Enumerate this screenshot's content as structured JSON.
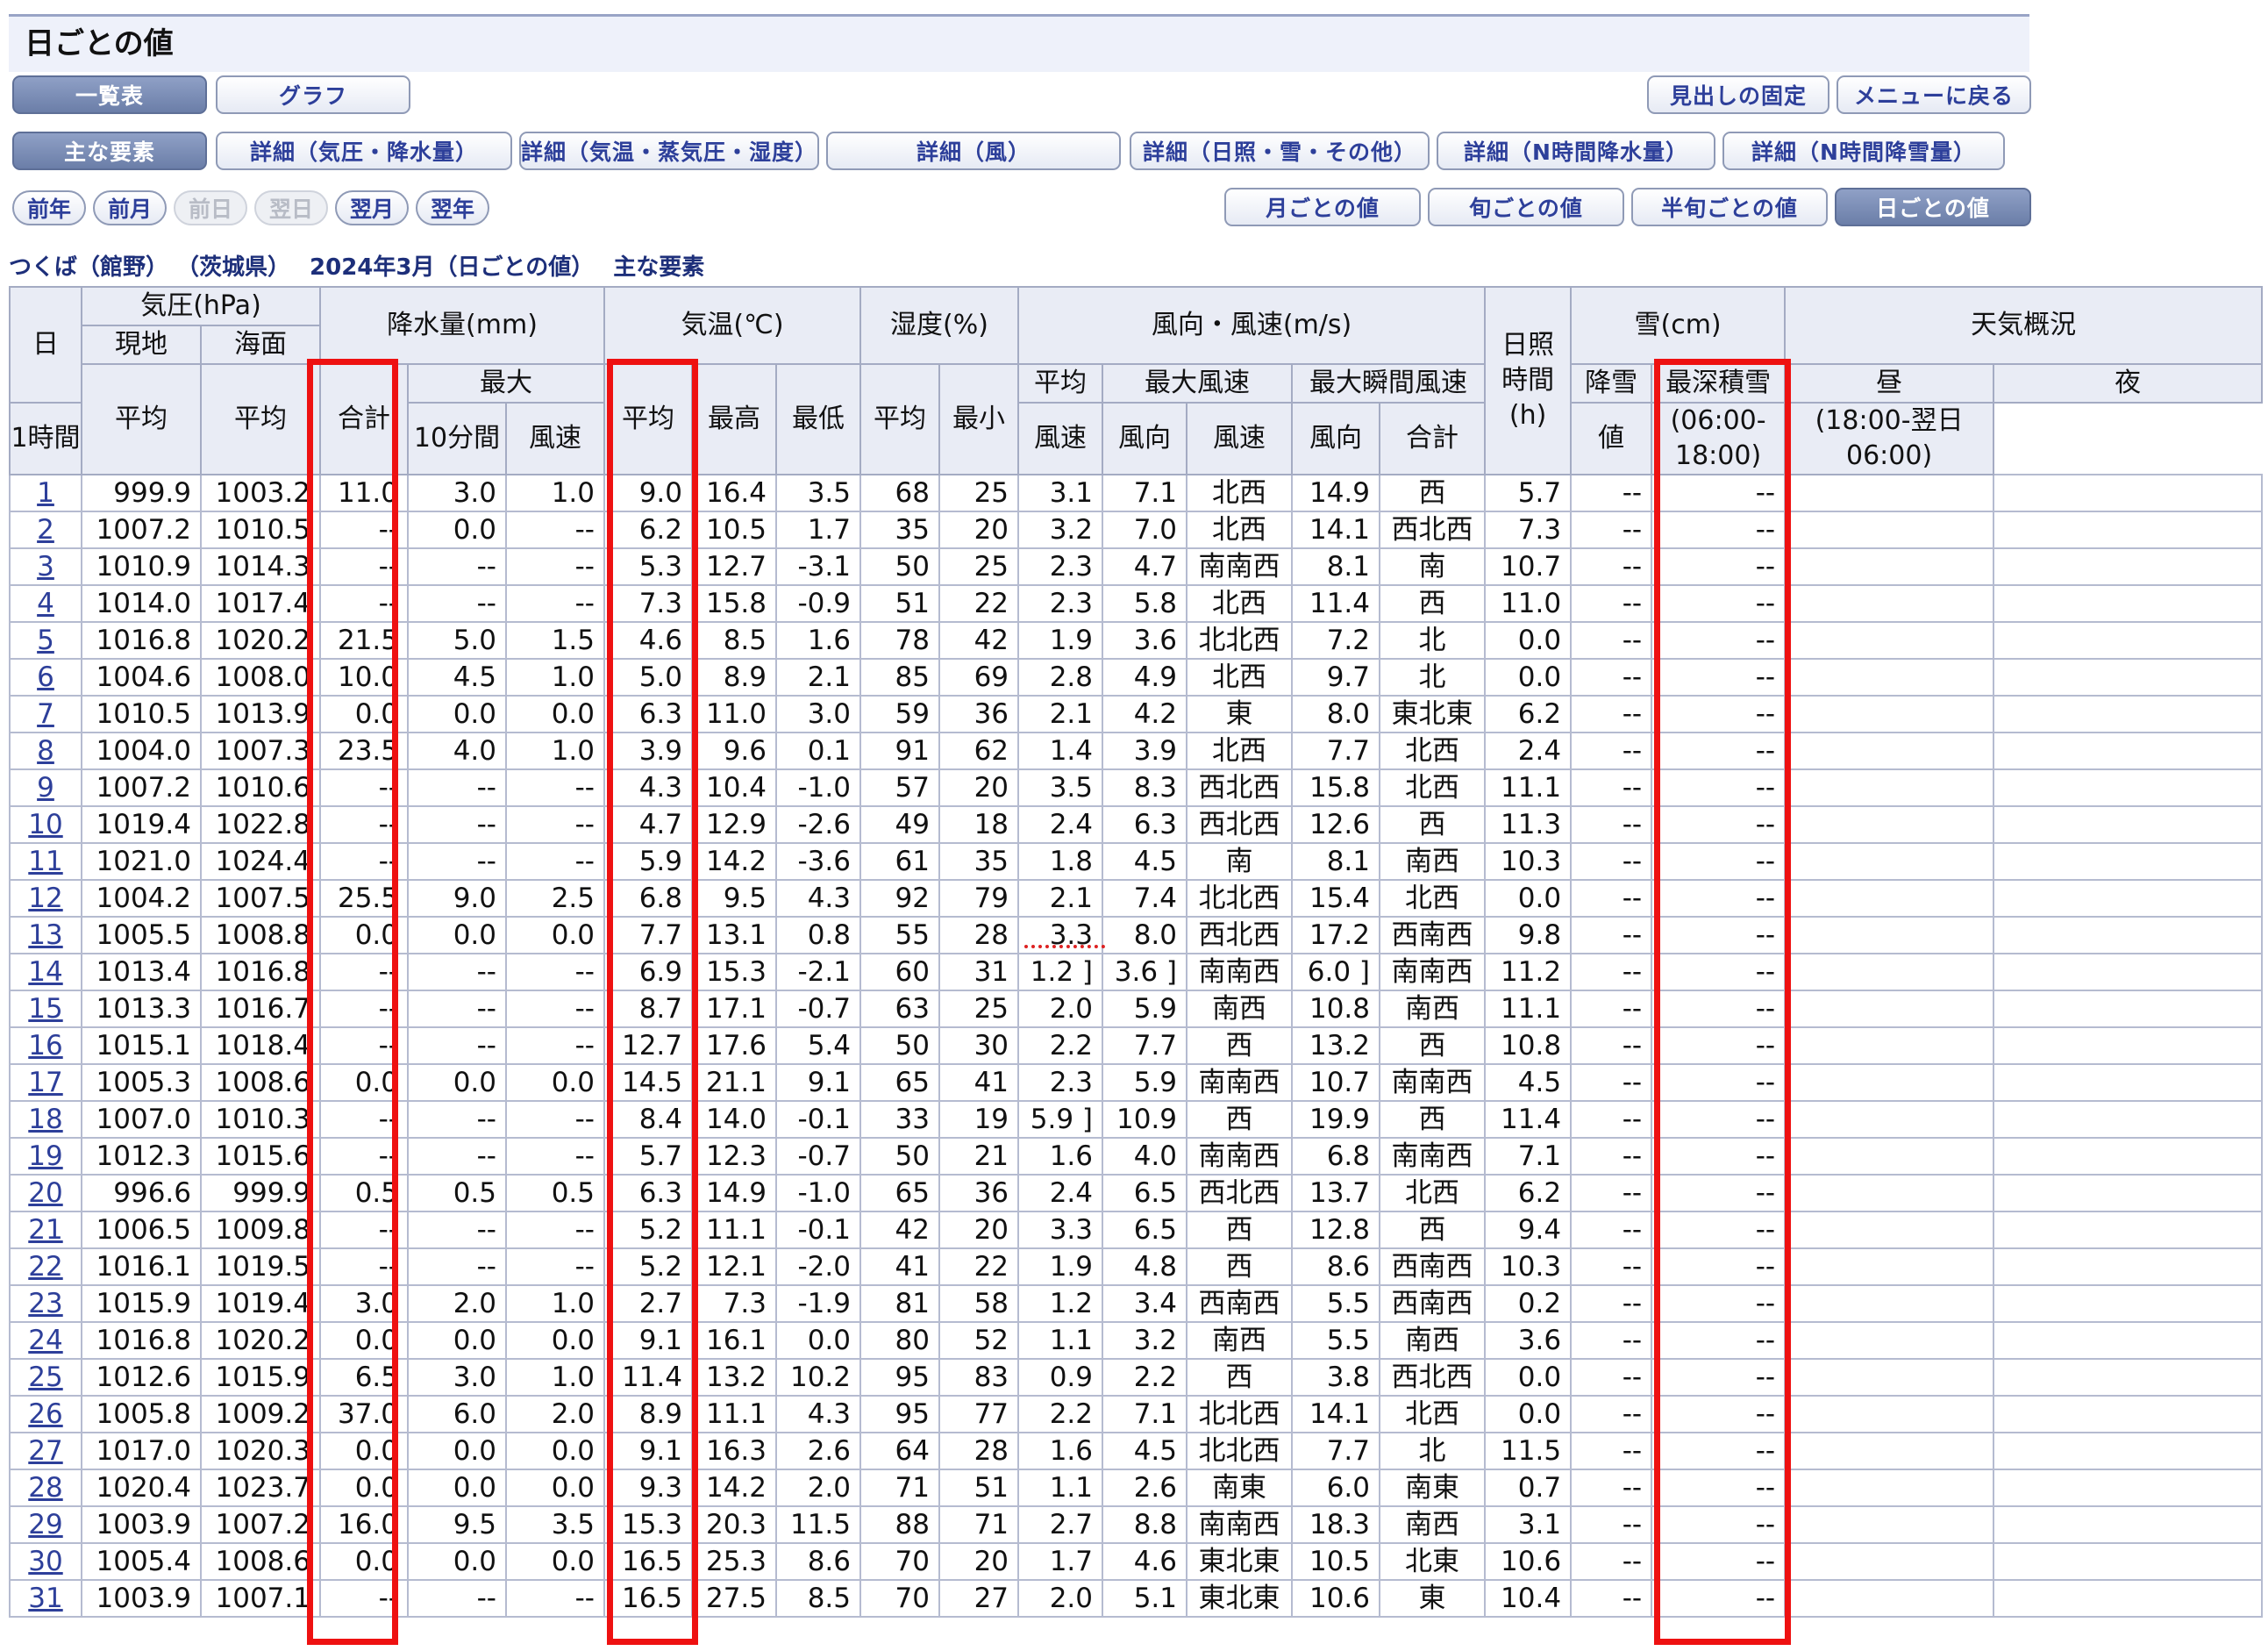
{
  "page": {
    "title": "日ごとの値",
    "caption": {
      "station": "つくば（館野）",
      "prefecture": "（茨城県）",
      "period": "2024年3月（日ごとの値）",
      "element": "主な要素"
    }
  },
  "view_buttons": [
    "一覧表",
    "グラフ"
  ],
  "util_buttons": [
    "見出しの固定",
    "メニューに戻る"
  ],
  "detail_tabs": [
    "主な要素",
    "詳細（気圧・降水量）",
    "詳細（気温・蒸気圧・湿度）",
    "詳細（風）",
    "詳細（日照・雪・その他）",
    "詳細（N時間降水量）",
    "詳細（N時間降雪量）"
  ],
  "nav_pills": [
    "前年",
    "前月",
    "前日",
    "翌日",
    "翌月",
    "翌年"
  ],
  "period_buttons": [
    "月ごとの値",
    "旬ごとの値",
    "半旬ごとの値",
    "日ごとの値"
  ],
  "headers": {
    "day": "日",
    "pressure": "気圧(hPa)",
    "station": "現地",
    "sea": "海面",
    "avg": "平均",
    "precip": "降水量(mm)",
    "total": "合計",
    "max": "最大",
    "h1": "1時間",
    "m10": "10分間",
    "temp": "気温(℃)",
    "high": "最高",
    "low": "最低",
    "humidity": "湿度(%)",
    "min": "最小",
    "wind": "風向・風速(m/s)",
    "avg_wind_1": "平均",
    "avg_wind_2": "風速",
    "max_wind": "最大風速",
    "max_gust": "最大瞬間風速",
    "speed": "風速",
    "direction": "風向",
    "sun_1": "日照",
    "sun_2": "時間",
    "sun_3": "(h)",
    "snow": "雪(cm)",
    "snowfall_1": "降雪",
    "snowfall_2": "合計",
    "depth_1": "最深積雪",
    "depth_2": "値",
    "weather": "天気概況",
    "day_time": "昼",
    "day_range": "(06:00-18:00)",
    "night_time": "夜",
    "night_range": "(18:00-翌日06:00)"
  },
  "rows": [
    [
      "1",
      "999.9",
      "1003.2",
      "11.0",
      "3.0",
      "1.0",
      "9.0",
      "16.4",
      "3.5",
      "68",
      "25",
      "3.1",
      "7.1",
      "北西",
      "14.9",
      "西",
      "5.7",
      "--",
      "--"
    ],
    [
      "2",
      "1007.2",
      "1010.5",
      "--",
      "0.0",
      "--",
      "6.2",
      "10.5",
      "1.7",
      "35",
      "20",
      "3.2",
      "7.0",
      "北西",
      "14.1",
      "西北西",
      "7.3",
      "--",
      "--"
    ],
    [
      "3",
      "1010.9",
      "1014.3",
      "--",
      "--",
      "--",
      "5.3",
      "12.7",
      "-3.1",
      "50",
      "25",
      "2.3",
      "4.7",
      "南南西",
      "8.1",
      "南",
      "10.7",
      "--",
      "--"
    ],
    [
      "4",
      "1014.0",
      "1017.4",
      "--",
      "--",
      "--",
      "7.3",
      "15.8",
      "-0.9",
      "51",
      "22",
      "2.3",
      "5.8",
      "北西",
      "11.4",
      "西",
      "11.0",
      "--",
      "--"
    ],
    [
      "5",
      "1016.8",
      "1020.2",
      "21.5",
      "5.0",
      "1.5",
      "4.6",
      "8.5",
      "1.6",
      "78",
      "42",
      "1.9",
      "3.6",
      "北北西",
      "7.2",
      "北",
      "0.0",
      "--",
      "--"
    ],
    [
      "6",
      "1004.6",
      "1008.0",
      "10.0",
      "4.5",
      "1.0",
      "5.0",
      "8.9",
      "2.1",
      "85",
      "69",
      "2.8",
      "4.9",
      "北西",
      "9.7",
      "北",
      "0.0",
      "--",
      "--"
    ],
    [
      "7",
      "1010.5",
      "1013.9",
      "0.0",
      "0.0",
      "0.0",
      "6.3",
      "11.0",
      "3.0",
      "59",
      "36",
      "2.1",
      "4.2",
      "東",
      "8.0",
      "東北東",
      "6.2",
      "--",
      "--"
    ],
    [
      "8",
      "1004.0",
      "1007.3",
      "23.5",
      "4.0",
      "1.0",
      "3.9",
      "9.6",
      "0.1",
      "91",
      "62",
      "1.4",
      "3.9",
      "北西",
      "7.7",
      "北西",
      "2.4",
      "--",
      "--"
    ],
    [
      "9",
      "1007.2",
      "1010.6",
      "--",
      "--",
      "--",
      "4.3",
      "10.4",
      "-1.0",
      "57",
      "20",
      "3.5",
      "8.3",
      "西北西",
      "15.8",
      "北西",
      "11.1",
      "--",
      "--"
    ],
    [
      "10",
      "1019.4",
      "1022.8",
      "--",
      "--",
      "--",
      "4.7",
      "12.9",
      "-2.6",
      "49",
      "18",
      "2.4",
      "6.3",
      "西北西",
      "12.6",
      "西",
      "11.3",
      "--",
      "--"
    ],
    [
      "11",
      "1021.0",
      "1024.4",
      "--",
      "--",
      "--",
      "5.9",
      "14.2",
      "-3.6",
      "61",
      "35",
      "1.8",
      "4.5",
      "南",
      "8.1",
      "南西",
      "10.3",
      "--",
      "--"
    ],
    [
      "12",
      "1004.2",
      "1007.5",
      "25.5",
      "9.0",
      "2.5",
      "6.8",
      "9.5",
      "4.3",
      "92",
      "79",
      "2.1",
      "7.4",
      "北北西",
      "15.4",
      "北西",
      "0.0",
      "--",
      "--"
    ],
    [
      "13",
      "1005.5",
      "1008.8",
      "0.0",
      "0.0",
      "0.0",
      "7.7",
      "13.1",
      "0.8",
      "55",
      "28",
      "3.3",
      "8.0",
      "西北西",
      "17.2",
      "西南西",
      "9.8",
      "--",
      "--"
    ],
    [
      "14",
      "1013.4",
      "1016.8",
      "--",
      "--",
      "--",
      "6.9",
      "15.3",
      "-2.1",
      "60",
      "31",
      "1.2 ]",
      "3.6 ]",
      "南南西",
      "6.0 ]",
      "南南西",
      "11.2",
      "--",
      "--"
    ],
    [
      "15",
      "1013.3",
      "1016.7",
      "--",
      "--",
      "--",
      "8.7",
      "17.1",
      "-0.7",
      "63",
      "25",
      "2.0",
      "5.9",
      "南西",
      "10.8",
      "南西",
      "11.1",
      "--",
      "--"
    ],
    [
      "16",
      "1015.1",
      "1018.4",
      "--",
      "--",
      "--",
      "12.7",
      "17.6",
      "5.4",
      "50",
      "30",
      "2.2",
      "7.7",
      "西",
      "13.2",
      "西",
      "10.8",
      "--",
      "--"
    ],
    [
      "17",
      "1005.3",
      "1008.6",
      "0.0",
      "0.0",
      "0.0",
      "14.5",
      "21.1",
      "9.1",
      "65",
      "41",
      "2.3",
      "5.9",
      "南南西",
      "10.7",
      "南南西",
      "4.5",
      "--",
      "--"
    ],
    [
      "18",
      "1007.0",
      "1010.3",
      "--",
      "--",
      "--",
      "8.4",
      "14.0",
      "-0.1",
      "33",
      "19",
      "5.9 ]",
      "10.9",
      "西",
      "19.9",
      "西",
      "11.4",
      "--",
      "--"
    ],
    [
      "19",
      "1012.3",
      "1015.6",
      "--",
      "--",
      "--",
      "5.7",
      "12.3",
      "-0.7",
      "50",
      "21",
      "1.6",
      "4.0",
      "南南西",
      "6.8",
      "南南西",
      "7.1",
      "--",
      "--"
    ],
    [
      "20",
      "996.6",
      "999.9",
      "0.5",
      "0.5",
      "0.5",
      "6.3",
      "14.9",
      "-1.0",
      "65",
      "36",
      "2.4",
      "6.5",
      "西北西",
      "13.7",
      "北西",
      "6.2",
      "--",
      "--"
    ],
    [
      "21",
      "1006.5",
      "1009.8",
      "--",
      "--",
      "--",
      "5.2",
      "11.1",
      "-0.1",
      "42",
      "20",
      "3.3",
      "6.5",
      "西",
      "12.8",
      "西",
      "9.4",
      "--",
      "--"
    ],
    [
      "22",
      "1016.1",
      "1019.5",
      "--",
      "--",
      "--",
      "5.2",
      "12.1",
      "-2.0",
      "41",
      "22",
      "1.9",
      "4.8",
      "西",
      "8.6",
      "西南西",
      "10.3",
      "--",
      "--"
    ],
    [
      "23",
      "1015.9",
      "1019.4",
      "3.0",
      "2.0",
      "1.0",
      "2.7",
      "7.3",
      "-1.9",
      "81",
      "58",
      "1.2",
      "3.4",
      "西南西",
      "5.5",
      "西南西",
      "0.2",
      "--",
      "--"
    ],
    [
      "24",
      "1016.8",
      "1020.2",
      "0.0",
      "0.0",
      "0.0",
      "9.1",
      "16.1",
      "0.0",
      "80",
      "52",
      "1.1",
      "3.2",
      "南西",
      "5.5",
      "南西",
      "3.6",
      "--",
      "--"
    ],
    [
      "25",
      "1012.6",
      "1015.9",
      "6.5",
      "3.0",
      "1.0",
      "11.4",
      "13.2",
      "10.2",
      "95",
      "83",
      "0.9",
      "2.2",
      "西",
      "3.8",
      "西北西",
      "0.0",
      "--",
      "--"
    ],
    [
      "26",
      "1005.8",
      "1009.2",
      "37.0",
      "6.0",
      "2.0",
      "8.9",
      "11.1",
      "4.3",
      "95",
      "77",
      "2.2",
      "7.1",
      "北北西",
      "14.1",
      "北西",
      "0.0",
      "--",
      "--"
    ],
    [
      "27",
      "1017.0",
      "1020.3",
      "0.0",
      "0.0",
      "0.0",
      "9.1",
      "16.3",
      "2.6",
      "64",
      "28",
      "1.6",
      "4.5",
      "北北西",
      "7.7",
      "北",
      "11.5",
      "--",
      "--"
    ],
    [
      "28",
      "1020.4",
      "1023.7",
      "0.0",
      "0.0",
      "0.0",
      "9.3",
      "14.2",
      "2.0",
      "71",
      "51",
      "1.1",
      "2.6",
      "南東",
      "6.0",
      "南東",
      "0.7",
      "--",
      "--"
    ],
    [
      "29",
      "1003.9",
      "1007.2",
      "16.0",
      "9.5",
      "3.5",
      "15.3",
      "20.3",
      "11.5",
      "88",
      "71",
      "2.7",
      "8.8",
      "南南西",
      "18.3",
      "南西",
      "3.1",
      "--",
      "--"
    ],
    [
      "30",
      "1005.4",
      "1008.6",
      "0.0",
      "0.0",
      "0.0",
      "16.5",
      "25.3",
      "8.6",
      "70",
      "20",
      "1.7",
      "4.6",
      "東北東",
      "10.5",
      "北東",
      "10.6",
      "--",
      "--"
    ],
    [
      "31",
      "1003.9",
      "1007.1",
      "--",
      "--",
      "--",
      "16.5",
      "27.5",
      "8.5",
      "70",
      "27",
      "2.0",
      "5.1",
      "東北東",
      "10.6",
      "東",
      "10.4",
      "--",
      "--"
    ]
  ],
  "colors": {
    "highlight": "#ee1111",
    "link": "#2d3f9a",
    "header_bg": "#e9ecf5"
  }
}
